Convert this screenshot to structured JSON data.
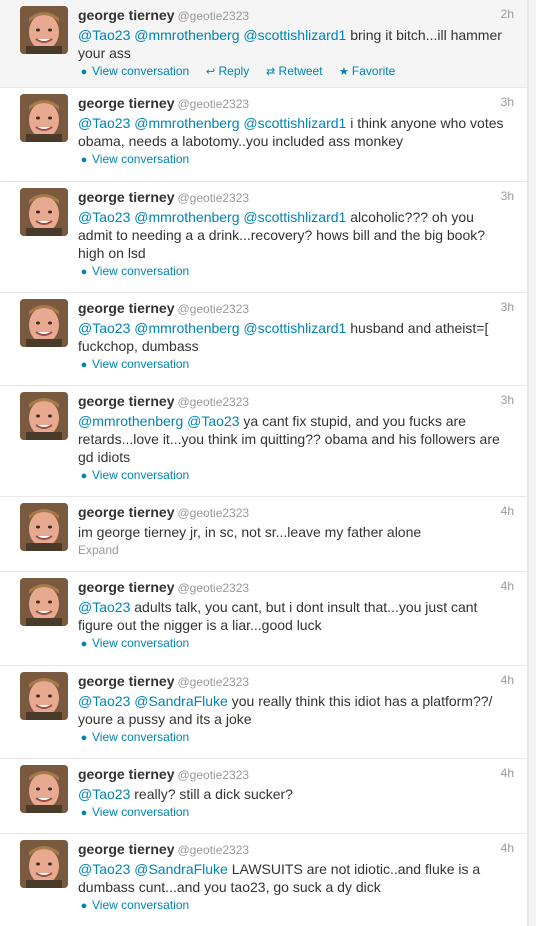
{
  "colors": {
    "link": "#0084b4",
    "muted": "#999999",
    "text": "#333333"
  },
  "tweets": [
    {
      "name": "george tierney",
      "handle": "@geotie2323",
      "time": "2h",
      "mentions": "@Tao23 @mmrothenberg @scottishlizard1",
      "text": " bring it bitch...ill hammer your ass",
      "link": "View conversation",
      "reply": "Reply",
      "retweet": "Retweet",
      "favorite": "Favorite"
    },
    {
      "name": "george tierney",
      "handle": "@geotie2323",
      "time": "3h",
      "mentions": "@Tao23 @mmrothenberg @scottishlizard1",
      "text": " i think anyone who votes obama, needs a labotomy..you included ass monkey",
      "link": "View conversation"
    },
    {
      "name": "george tierney",
      "handle": "@geotie2323",
      "time": "3h",
      "mentions": "@Tao23 @mmrothenberg @scottishlizard1",
      "text": " alcoholic??? oh you admit to needing a a drink...recovery? hows bill and the big book? high on lsd",
      "link": "View conversation"
    },
    {
      "name": "george tierney",
      "handle": "@geotie2323",
      "time": "3h",
      "mentions": "@Tao23 @mmrothenberg @scottishlizard1",
      "text": " husband and atheist=[ fuckchop, dumbass",
      "link": "View conversation"
    },
    {
      "name": "george tierney",
      "handle": "@geotie2323",
      "time": "3h",
      "mentions": "@mmrothenberg @Tao23",
      "text": " ya cant fix stupid, and you fucks are retards...love it...you think im quitting?? obama and his followers are gd idiots",
      "link": "View conversation"
    },
    {
      "name": "george tierney",
      "handle": "@geotie2323",
      "time": "4h",
      "mentions": "",
      "text": "im george tierney jr, in sc, not sr...leave my father alone",
      "link": "Expand"
    },
    {
      "name": "george tierney",
      "handle": "@geotie2323",
      "time": "4h",
      "mentions": "@Tao23",
      "text": " adults talk, you cant, but i dont insult that...you just cant figure out the nigger is a liar...good luck",
      "link": "View conversation"
    },
    {
      "name": "george tierney",
      "handle": "@geotie2323",
      "time": "4h",
      "mentions": "@Tao23 @SandraFluke",
      "text": " you really think this idiot has a platform??/ youre a pussy and its a joke",
      "link": "View conversation"
    },
    {
      "name": "george tierney",
      "handle": "@geotie2323",
      "time": "4h",
      "mentions": "@Tao23",
      "text": " really? still a dick sucker?",
      "link": "View conversation"
    },
    {
      "name": "george tierney",
      "handle": "@geotie2323",
      "time": "4h",
      "mentions": "@Tao23 @SandraFluke",
      "text": " LAWSUITS are not idiotic..and fluke is a dumbass cunt...and you tao23, go suck a dy dick",
      "link": "View conversation"
    }
  ]
}
